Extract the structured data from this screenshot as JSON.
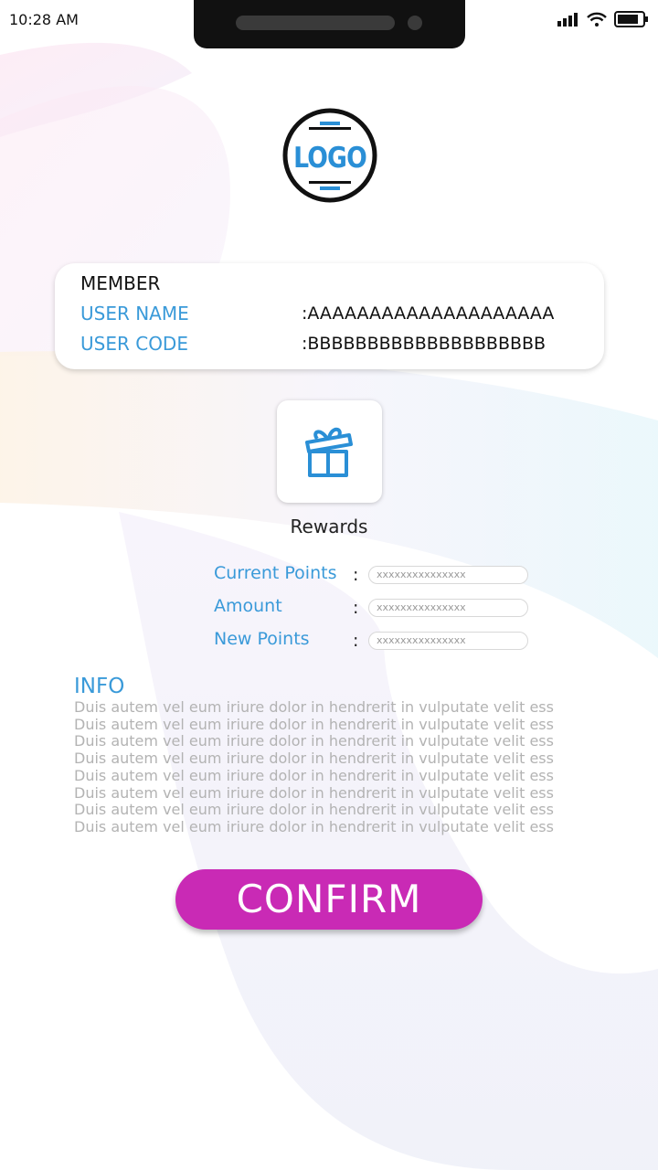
{
  "status_bar": {
    "time": "10:28 AM"
  },
  "logo": {
    "text": "LOGO"
  },
  "member_card": {
    "heading": "MEMBER",
    "user_name_label": "USER NAME",
    "user_name_value": ":AAAAAAAAAAAAAAAAAAAA",
    "user_code_label": "USER CODE",
    "user_code_value": ":BBBBBBBBBBBBBBBBBBBB"
  },
  "rewards": {
    "label": "Rewards",
    "icon": "gift-icon"
  },
  "points_form": {
    "current_points_label": "Current Points",
    "amount_label": "Amount",
    "new_points_label": "New Points",
    "separator": ":",
    "current_points_value": "xxxxxxxxxxxxxxx",
    "amount_value": "xxxxxxxxxxxxxxx",
    "new_points_value": "xxxxxxxxxxxxxxx"
  },
  "info": {
    "title": "INFO",
    "lines": [
      "Duis autem vel eum iriure dolor in hendrerit in vulputate velit ess",
      "Duis autem vel eum iriure dolor in hendrerit in vulputate velit ess",
      "Duis autem vel eum iriure dolor in hendrerit in vulputate velit ess",
      "Duis autem vel eum iriure dolor in hendrerit in vulputate velit ess",
      "Duis autem vel eum iriure dolor in hendrerit in vulputate velit ess",
      "Duis autem vel eum iriure dolor in hendrerit in vulputate velit ess",
      "Duis autem vel eum iriure dolor in hendrerit in vulputate velit ess",
      "Duis autem vel eum iriure dolor in hendrerit in vulputate velit ess"
    ]
  },
  "confirm_button": {
    "label": "CONFIRM"
  },
  "colors": {
    "accent_blue": "#3a9ad9",
    "confirm_magenta": "#c92ab5",
    "info_text_gray": "#b3b3b3"
  }
}
